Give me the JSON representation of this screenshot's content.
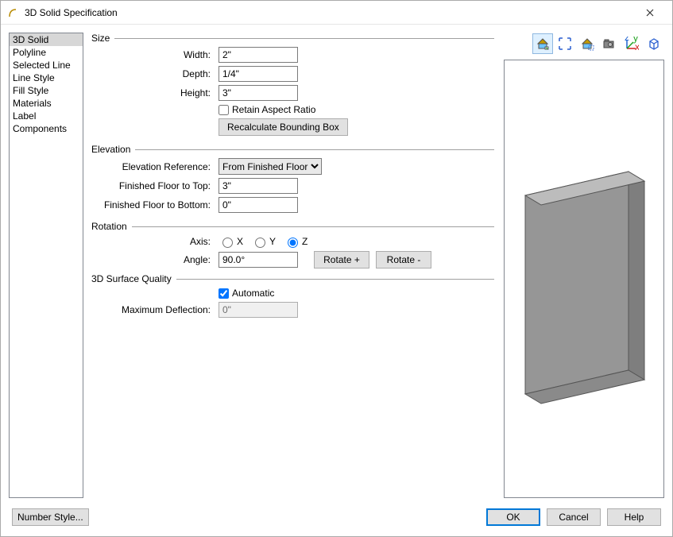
{
  "window": {
    "title": "3D Solid Specification"
  },
  "nav": {
    "items": [
      "3D Solid",
      "Polyline",
      "Selected Line",
      "Line Style",
      "Fill Style",
      "Materials",
      "Label",
      "Components"
    ],
    "selected": 0
  },
  "groups": {
    "size": "Size",
    "elevation": "Elevation",
    "rotation": "Rotation",
    "quality": "3D Surface Quality"
  },
  "size": {
    "width_label": "Width:",
    "width": "2\"",
    "depth_label": "Depth:",
    "depth": "1/4\"",
    "height_label": "Height:",
    "height": "3\"",
    "retain_label": "Retain Aspect Ratio",
    "retain_checked": false,
    "recalc_label": "Recalculate Bounding Box"
  },
  "elevation": {
    "ref_label": "Elevation Reference:",
    "ref_value": "From Finished Floor",
    "top_label": "Finished Floor to Top:",
    "top": "3\"",
    "bottom_label": "Finished Floor to Bottom:",
    "bottom": "0\""
  },
  "rotation": {
    "axis_label": "Axis:",
    "axis_x": "X",
    "axis_y": "Y",
    "axis_z": "Z",
    "axis_selected": "Z",
    "angle_label": "Angle:",
    "angle": "90.0°",
    "rotate_plus": "Rotate +",
    "rotate_minus": "Rotate -"
  },
  "quality": {
    "auto_label": "Automatic",
    "auto_checked": true,
    "deflection_label": "Maximum Deflection:",
    "deflection": "0\""
  },
  "footer": {
    "number_style": "Number Style...",
    "ok": "OK",
    "cancel": "Cancel",
    "help": "Help"
  },
  "toolbar": {
    "icons": [
      "house-color-icon",
      "expand-arrows-icon",
      "house-select-icon",
      "camera-icon",
      "axes-icon",
      "cube-icon"
    ],
    "selected": 0
  }
}
